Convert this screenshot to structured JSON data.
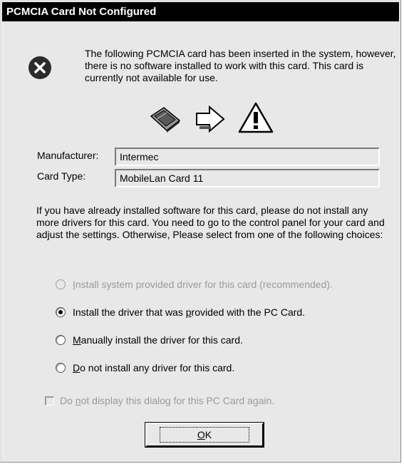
{
  "window": {
    "title": "PCMCIA Card Not Configured"
  },
  "message": "The following PCMCIA card has been inserted in the system, however, there is no software installed to work with this card. This card is currently not available for use.",
  "icons": {
    "error": "error-icon",
    "card": "pc-card-icon",
    "arrow": "arrow-icon",
    "warning": "warning-icon"
  },
  "fields": {
    "manufacturer_label": "Manufacturer:",
    "manufacturer_value": "Intermec",
    "card_type_label": "Card Type:",
    "card_type_value": "MobileLan Card 11"
  },
  "instructions": "If you have already installed software for this card, please do not install any more drivers for this card.  You need to go to the control panel for your card and adjust the settings.  Otherwise, Please select from one of the following choices:",
  "options": [
    {
      "pre": "",
      "accel": "I",
      "post": "nstall system provided driver for this card (recommended).",
      "checked": false,
      "disabled": true
    },
    {
      "pre": "Install the driver that was ",
      "accel": "p",
      "post": "rovided with the PC Card.",
      "checked": true,
      "disabled": false
    },
    {
      "pre": "",
      "accel": "M",
      "post": "anually install the driver for this card.",
      "checked": false,
      "disabled": false
    },
    {
      "pre": "",
      "accel": "D",
      "post": "o not install any driver for this card.",
      "checked": false,
      "disabled": false
    }
  ],
  "dont_show": {
    "pre": "Do ",
    "accel": "n",
    "post": "ot display this dialog for this PC Card again.",
    "checked": false,
    "disabled": true
  },
  "ok_button": {
    "accel": "O",
    "post": "K"
  }
}
